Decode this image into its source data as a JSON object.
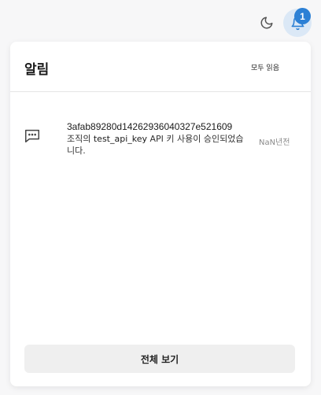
{
  "topbar": {
    "theme_icon": "moon-icon",
    "bell_icon": "bell-icon",
    "notification_count": "1",
    "accent_color": "#2c80d5"
  },
  "panel": {
    "title": "알림",
    "mark_all_read": "모두 읽음",
    "view_all": "전체 보기"
  },
  "notifications": [
    {
      "icon": "message-square-icon",
      "title": "3afab89280d14262936040327e521609",
      "body_prefix": "조직의 ",
      "body_key": "test_api_key",
      "body_suffix": " API 키 사용이 승인되었습니다.",
      "time": "NaN년전"
    }
  ]
}
